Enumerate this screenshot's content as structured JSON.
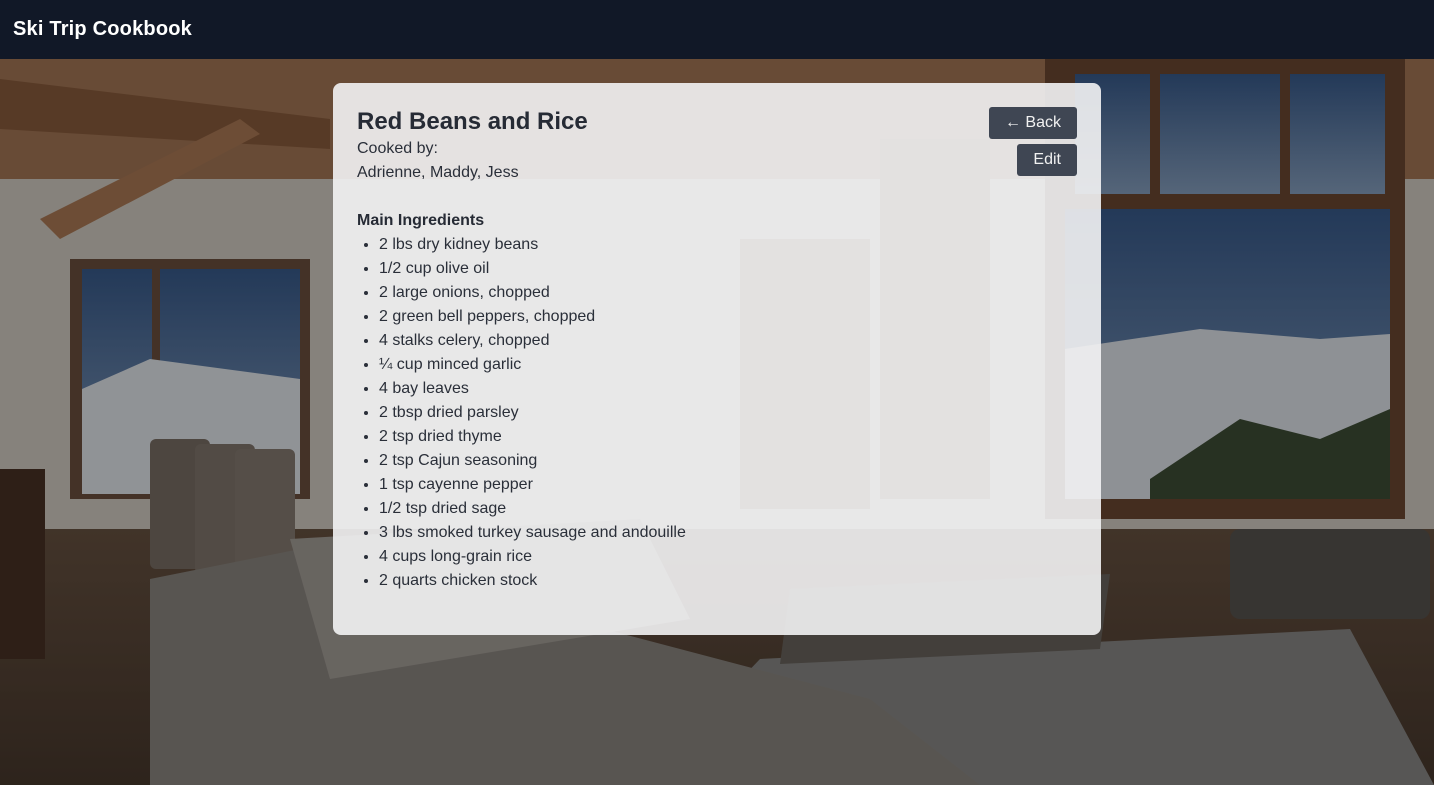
{
  "app": {
    "title": "Ski Trip Cookbook"
  },
  "recipe": {
    "title": "Red Beans and Rice",
    "cooked_by_label": "Cooked by:",
    "cooked_by": "Adrienne, Maddy, Jess",
    "ingredients_heading": "Main Ingredients",
    "ingredients": [
      "2 lbs dry kidney beans",
      "1/2 cup olive oil",
      "2 large onions, chopped",
      "2 green bell peppers, chopped",
      "4 stalks celery, chopped",
      "¼ cup minced garlic",
      "4 bay leaves",
      "2 tbsp dried parsley",
      "2 tsp dried thyme",
      "2 tsp Cajun seasoning",
      "1 tsp cayenne pepper",
      "1/2 tsp dried sage",
      "3 lbs smoked turkey sausage and andouille",
      "4 cups long-grain rice",
      "2 quarts chicken stock"
    ]
  },
  "actions": {
    "back_label": "← Back",
    "edit_label": "Edit"
  },
  "colors": {
    "topbar": "#111827",
    "button": "#3f4653",
    "card": "#f3f3f4"
  }
}
